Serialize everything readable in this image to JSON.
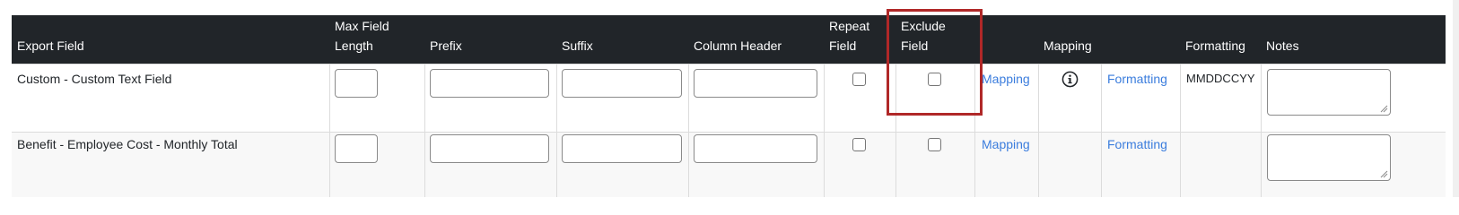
{
  "columns": {
    "export_field": "Export Field",
    "max_field_length_line1": "Max Field",
    "max_field_length_line2": "Length",
    "prefix": "Prefix",
    "suffix": "Suffix",
    "column_header": "Column Header",
    "repeat_field_line1": "Repeat",
    "repeat_field_line2": "Field",
    "exclude_field_line1": "Exclude",
    "exclude_field_line2": "Field",
    "mapping": "Mapping",
    "formatting": "Formatting",
    "notes": "Notes"
  },
  "rows": [
    {
      "export_field": "Custom - Custom Text Field",
      "max_field_length": "",
      "prefix": "",
      "suffix": "",
      "column_header": "",
      "repeat_field": false,
      "exclude_field": false,
      "mapping_link": "Mapping",
      "mapping_icon": "info-circle-icon",
      "formatting_link": "Formatting",
      "formatting_value": "MMDDCCYY",
      "notes": ""
    },
    {
      "export_field": "Benefit - Employee Cost - Monthly Total",
      "max_field_length": "",
      "prefix": "",
      "suffix": "",
      "column_header": "",
      "repeat_field": false,
      "exclude_field": false,
      "mapping_link": "Mapping",
      "formatting_link": "Formatting",
      "formatting_value": "",
      "notes": ""
    }
  ],
  "colors": {
    "header_bg": "#212529",
    "link": "#3b7ddd",
    "highlight_border": "#b02828"
  }
}
